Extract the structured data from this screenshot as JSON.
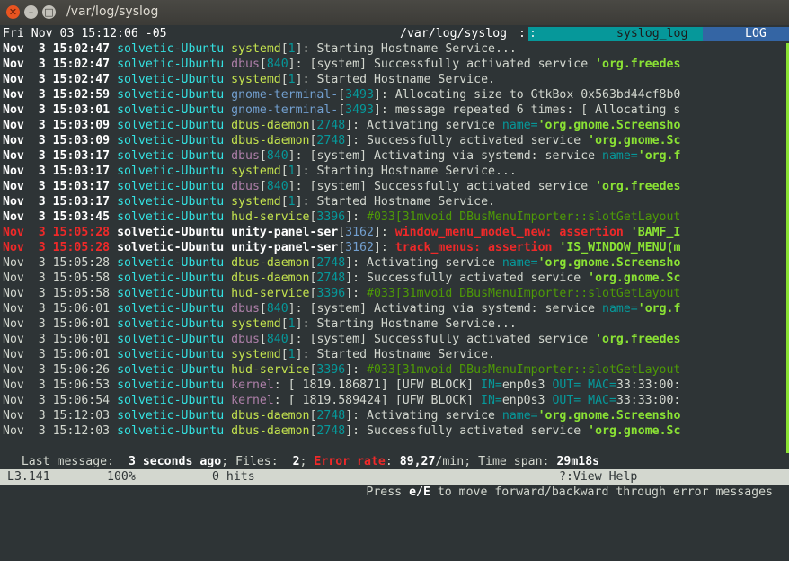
{
  "window": {
    "title": "/var/log/syslog"
  },
  "header": {
    "datetime": "Fri Nov 03 15:12:06 -05",
    "file": "/var/log/syslog",
    "colon": ":",
    "sep": ":",
    "view": "syslog_log",
    "mode": "LOG"
  },
  "logs": [
    {
      "d": "Nov",
      "t": "3 15:02:47",
      "h": "solvetic-Ubuntu",
      "p": "systemd",
      "pid": "1",
      "m": "Starting Hostname Service...",
      "q": ""
    },
    {
      "d": "Nov",
      "t": "3 15:02:47",
      "h": "solvetic-Ubuntu",
      "p": "dbus",
      "pid": "840",
      "m": "[system] Successfully activated service ",
      "q": "'org.freedes"
    },
    {
      "d": "Nov",
      "t": "3 15:02:47",
      "h": "solvetic-Ubuntu",
      "p": "systemd",
      "pid": "1",
      "m": "Started Hostname Service.",
      "q": ""
    },
    {
      "d": "Nov",
      "t": "3 15:02:59",
      "h": "solvetic-Ubuntu",
      "p": "gnome-terminal-",
      "pid": "3493",
      "m": "Allocating size to GtkBox 0x563bd44cf8b0",
      "q": ""
    },
    {
      "d": "Nov",
      "t": "3 15:03:01",
      "h": "solvetic-Ubuntu",
      "p": "gnome-terminal-",
      "pid": "3493",
      "m": "message repeated 6 times: [ Allocating s",
      "q": ""
    },
    {
      "d": "Nov",
      "t": "3 15:03:09",
      "h": "solvetic-Ubuntu",
      "p": "dbus-daemon",
      "pid": "2748",
      "m": "Activating service ",
      "k": "name=",
      "q": "'org.gnome.Screensho"
    },
    {
      "d": "Nov",
      "t": "3 15:03:09",
      "h": "solvetic-Ubuntu",
      "p": "dbus-daemon",
      "pid": "2748",
      "m": "Successfully activated service ",
      "q": "'org.gnome.Sc"
    },
    {
      "d": "Nov",
      "t": "3 15:03:17",
      "h": "solvetic-Ubuntu",
      "p": "dbus",
      "pid": "840",
      "m": "[system] Activating via systemd: service ",
      "k": "name=",
      "q": "'org.f"
    },
    {
      "d": "Nov",
      "t": "3 15:03:17",
      "h": "solvetic-Ubuntu",
      "p": "systemd",
      "pid": "1",
      "m": "Starting Hostname Service...",
      "q": ""
    },
    {
      "d": "Nov",
      "t": "3 15:03:17",
      "h": "solvetic-Ubuntu",
      "p": "dbus",
      "pid": "840",
      "m": "[system] Successfully activated service ",
      "q": "'org.freedes"
    },
    {
      "d": "Nov",
      "t": "3 15:03:17",
      "h": "solvetic-Ubuntu",
      "p": "systemd",
      "pid": "1",
      "m": "Started Hostname Service.",
      "q": ""
    },
    {
      "d": "Nov",
      "t": "3 15:03:45",
      "h": "solvetic-Ubuntu",
      "p": "hud-service",
      "pid": "3396",
      "m": "#033[31mvoid DBusMenuImporter::slotGetLayout",
      "q": ""
    },
    {
      "d": "Nov",
      "t": "3 15:05:28",
      "h": "solvetic-Ubuntu",
      "p": "unity-panel-ser",
      "pid": "3162",
      "m": "window_menu_model_new: assertion ",
      "q": "'BAMF_I"
    },
    {
      "d": "Nov",
      "t": "3 15:05:28",
      "h": "solvetic-Ubuntu",
      "p": "unity-panel-ser",
      "pid": "3162",
      "m": "track_menus: assertion ",
      "q": "'IS_WINDOW_MENU(m"
    },
    {
      "d": "Nov",
      "t": "3 15:05:28",
      "h": "solvetic-Ubuntu",
      "p": "dbus-daemon",
      "pid": "2748",
      "m": "Activating service ",
      "k": "name=",
      "q": "'org.gnome.Screensho"
    },
    {
      "d": "Nov",
      "t": "3 15:05:58",
      "h": "solvetic-Ubuntu",
      "p": "dbus-daemon",
      "pid": "2748",
      "m": "Successfully activated service ",
      "q": "'org.gnome.Sc"
    },
    {
      "d": "Nov",
      "t": "3 15:05:58",
      "h": "solvetic-Ubuntu",
      "p": "hud-service",
      "pid": "3396",
      "m": "#033[31mvoid DBusMenuImporter::slotGetLayout",
      "q": ""
    },
    {
      "d": "Nov",
      "t": "3 15:06:01",
      "h": "solvetic-Ubuntu",
      "p": "dbus",
      "pid": "840",
      "m": "[system] Activating via systemd: service ",
      "k": "name=",
      "q": "'org.f"
    },
    {
      "d": "Nov",
      "t": "3 15:06:01",
      "h": "solvetic-Ubuntu",
      "p": "systemd",
      "pid": "1",
      "m": "Starting Hostname Service...",
      "q": ""
    },
    {
      "d": "Nov",
      "t": "3 15:06:01",
      "h": "solvetic-Ubuntu",
      "p": "dbus",
      "pid": "840",
      "m": "[system] Successfully activated service ",
      "q": "'org.freedes"
    },
    {
      "d": "Nov",
      "t": "3 15:06:01",
      "h": "solvetic-Ubuntu",
      "p": "systemd",
      "pid": "1",
      "m": "Started Hostname Service.",
      "q": ""
    },
    {
      "d": "Nov",
      "t": "3 15:06:26",
      "h": "solvetic-Ubuntu",
      "p": "hud-service",
      "pid": "3396",
      "m": "#033[31mvoid DBusMenuImporter::slotGetLayout",
      "q": ""
    },
    {
      "d": "Nov",
      "t": "3 15:06:53",
      "h": "solvetic-Ubuntu",
      "p": "kernel",
      "pid": "",
      "m": "[ 1819.186871] [UFW BLOCK] ",
      "k": "IN=",
      "m2": "enp0s3 ",
      "k2": "OUT= MAC=",
      "m3": "33:33:00:",
      "q": ""
    },
    {
      "d": "Nov",
      "t": "3 15:06:54",
      "h": "solvetic-Ubuntu",
      "p": "kernel",
      "pid": "",
      "m": "[ 1819.589424] [UFW BLOCK] ",
      "k": "IN=",
      "m2": "enp0s3 ",
      "k2": "OUT= MAC=",
      "m3": "33:33:00:",
      "q": ""
    },
    {
      "d": "Nov",
      "t": "3 15:12:03",
      "h": "solvetic-Ubuntu",
      "p": "dbus-daemon",
      "pid": "2748",
      "m": "Activating service ",
      "k": "name=",
      "q": "'org.gnome.Screensho"
    },
    {
      "d": "Nov",
      "t": "3 15:12:03",
      "h": "solvetic-Ubuntu",
      "p": "dbus-daemon",
      "pid": "2748",
      "m": "Successfully activated service ",
      "q": "'org.gnome.Sc"
    }
  ],
  "status": {
    "last_label": "Last message:",
    "last_value": "3 seconds ago",
    "files_label": "Files:",
    "files_value": "2",
    "err_label": "Error rate",
    "err_value": "89,27",
    "err_unit": "/min",
    "span_label": "Time span:",
    "span_value": "29m18s"
  },
  "bottombar": {
    "line": "L3.141",
    "percent": "100%",
    "hits": "0 hits",
    "help": "?:View Help"
  },
  "help": {
    "pre": "Press ",
    "key": "e/E",
    "post": " to move forward/backward through error messages"
  },
  "colors": {
    "background": "#2e3436",
    "cyan": "#34e2e2",
    "green": "#8ae234",
    "red": "#ef2929",
    "magenta": "#ad7fa8",
    "blue": "#3465a4"
  }
}
